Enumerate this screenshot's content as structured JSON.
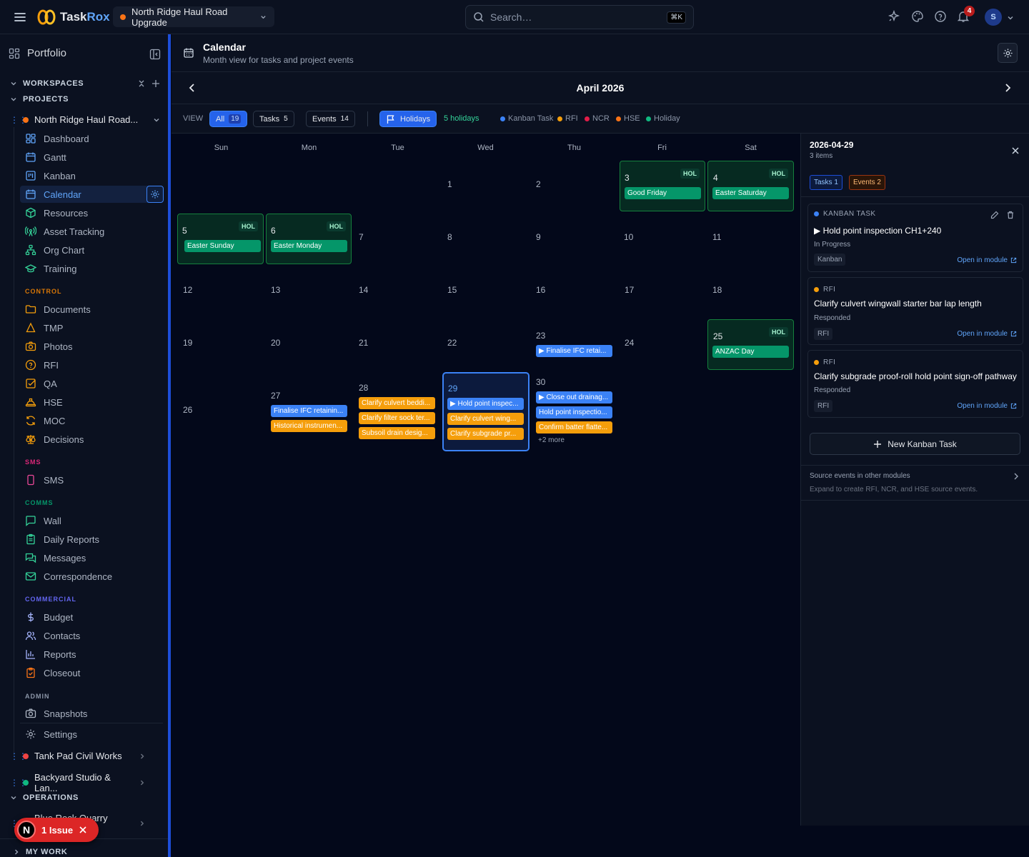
{
  "app": {
    "name_part1": "Task",
    "name_part2": "Rox"
  },
  "project_selector": {
    "label": "North Ridge Haul Road Upgrade"
  },
  "search": {
    "placeholder": "Search…",
    "shortcut": "⌘K"
  },
  "notifications": {
    "count": "4"
  },
  "user": {
    "initial": "S"
  },
  "sidebar": {
    "portfolio": "Portfolio",
    "workspaces": "WORKSPACES",
    "projects": "PROJECTS",
    "current_project": "North Ridge Haul Road...",
    "nav": [
      "Dashboard",
      "Gantt",
      "Kanban",
      "Calendar",
      "Resources",
      "Asset Tracking",
      "Org Chart",
      "Training"
    ],
    "control_label": "CONTROL",
    "control": [
      "Documents",
      "TMP",
      "Photos",
      "RFI",
      "QA",
      "HSE",
      "MOC",
      "Decisions"
    ],
    "sms_label": "SMS",
    "sms": [
      "SMS"
    ],
    "comms_label": "COMMS",
    "comms": [
      "Wall",
      "Daily Reports",
      "Messages",
      "Correspondence"
    ],
    "commercial_label": "COMMERCIAL",
    "commercial": [
      "Budget",
      "Contacts",
      "Reports",
      "Closeout"
    ],
    "admin_label": "ADMIN",
    "admin": [
      "Snapshots",
      "Settings"
    ],
    "other_projects": [
      "Tank Pad Civil Works",
      "Backyard Studio & Lan..."
    ],
    "operations": "OPERATIONS",
    "operations_project": "Blue Rock Quarry Oper...",
    "my_work": "MY WORK",
    "issue_label": "1 Issue",
    "issue_initial": "N"
  },
  "header": {
    "title": "Calendar",
    "subtitle": "Month view for tasks and project events"
  },
  "month": {
    "label": "April 2026"
  },
  "filters": {
    "view_label": "VIEW",
    "all": "All",
    "all_count": "19",
    "tasks": "Tasks",
    "tasks_count": "5",
    "events": "Events",
    "events_count": "14",
    "holidays": "Holidays",
    "holidays_count": "5 holidays",
    "legend": [
      {
        "label": "Kanban Task",
        "color": "#3b82f6"
      },
      {
        "label": "RFI",
        "color": "#f59e0b"
      },
      {
        "label": "NCR",
        "color": "#e11d48"
      },
      {
        "label": "HSE",
        "color": "#f97316"
      },
      {
        "label": "Holiday",
        "color": "#10b981"
      }
    ]
  },
  "calendar": {
    "weekdays": [
      "Sun",
      "Mon",
      "Tue",
      "Wed",
      "Thu",
      "Fri",
      "Sat"
    ],
    "hol_tag": "HOL",
    "events": {
      "d3": "Good Friday",
      "d4": "Easter Saturday",
      "d5": "Easter Sunday",
      "d6": "Easter Monday",
      "d25": "ANZAC Day",
      "d23a": "▶ Finalise IFC retai...",
      "d27a": "Finalise IFC retainin...",
      "d27b": "Historical instrumen...",
      "d28a": "Clarify culvert beddi...",
      "d28b": "Clarify filter sock ter...",
      "d28c": "Subsoil drain desig...",
      "d29a": "▶ Hold point inspec...",
      "d29b": "Clarify culvert wing...",
      "d29c": "Clarify subgrade pr...",
      "d30a": "▶ Close out drainag...",
      "d30b": "Hold point inspectio...",
      "d30c": "Confirm batter flatte...",
      "d30more": "+2 more"
    }
  },
  "panel": {
    "date": "2026-04-29",
    "count": "3 items",
    "tab_tasks": "Tasks 1",
    "tab_events": "Events 2",
    "cards": [
      {
        "type": "KANBAN TASK",
        "title": "▶ Hold point inspection CH1+240",
        "status": "In Progress",
        "module": "Kanban",
        "open": "Open in module",
        "color": "#3b82f6"
      },
      {
        "type": "RFI",
        "title": "Clarify culvert wingwall starter bar lap length",
        "status": "Responded",
        "module": "RFI",
        "open": "Open in module",
        "color": "#f59e0b"
      },
      {
        "type": "RFI",
        "title": "Clarify subgrade proof-roll hold point sign-off pathway",
        "status": "Responded",
        "module": "RFI",
        "open": "Open in module",
        "color": "#f59e0b"
      }
    ],
    "new_button": "New Kanban Task",
    "source_title": "Source events in other modules",
    "source_sub": "Expand to create RFI, NCR, and HSE source events."
  }
}
